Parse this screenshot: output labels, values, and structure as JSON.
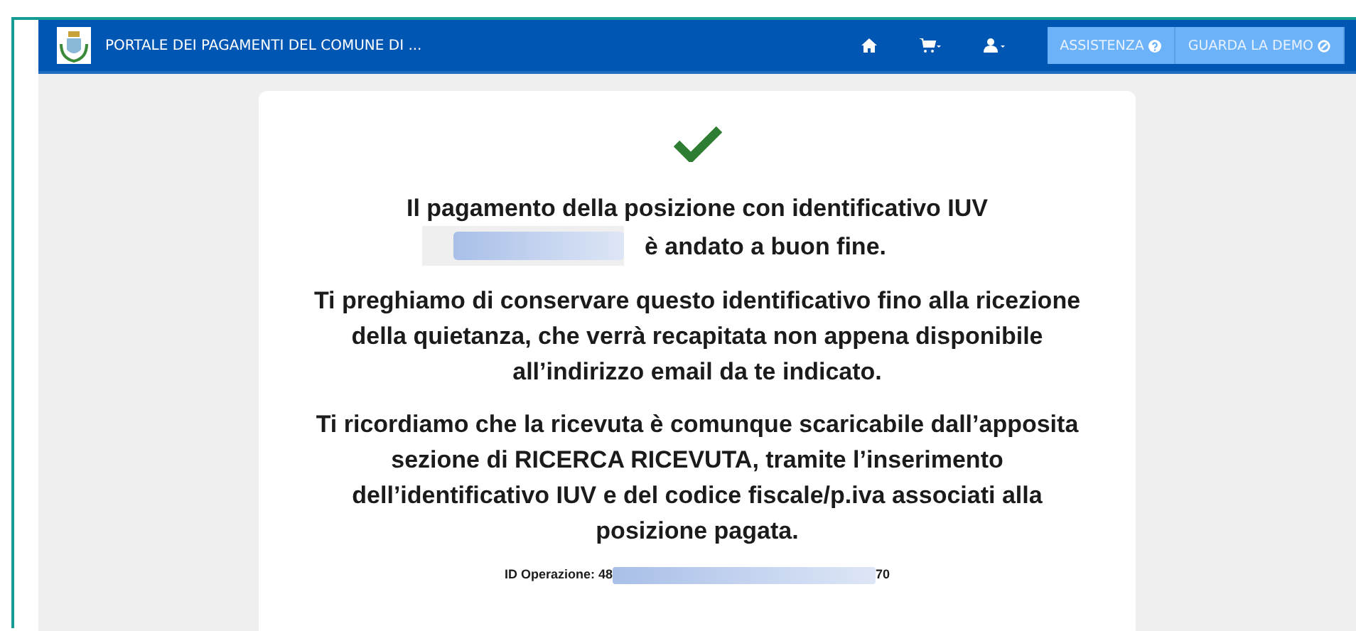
{
  "navbar": {
    "title": "PORTALE DEI PAGAMENTI DEL COMUNE DI ...",
    "buttons": [
      {
        "label": "ASSISTENZA",
        "kind": "help"
      },
      {
        "label": "GUARDA LA DEMO",
        "kind": "demo"
      }
    ]
  },
  "message": {
    "heading": "Il pagamento della posizione con identificativo IUV",
    "heading_end": "è andato a buon fine.",
    "paragraphs": [
      "Ti preghiamo di conservare questo identificativo fino alla ricezione della quietanza, che verrà recapitata non appena disponibile all’indirizzo email da te indicato.",
      "Ti ricordiamo che la ricevuta è comunque scaricabile dall’apposita sezione di RICERCA RICEVUTA, tramite l’inserimento dell’identificativo IUV e del codice fiscale/p.iva associati alla posizione pagata."
    ],
    "operation_label": "ID Operazione: 48",
    "operation_end": "70"
  }
}
